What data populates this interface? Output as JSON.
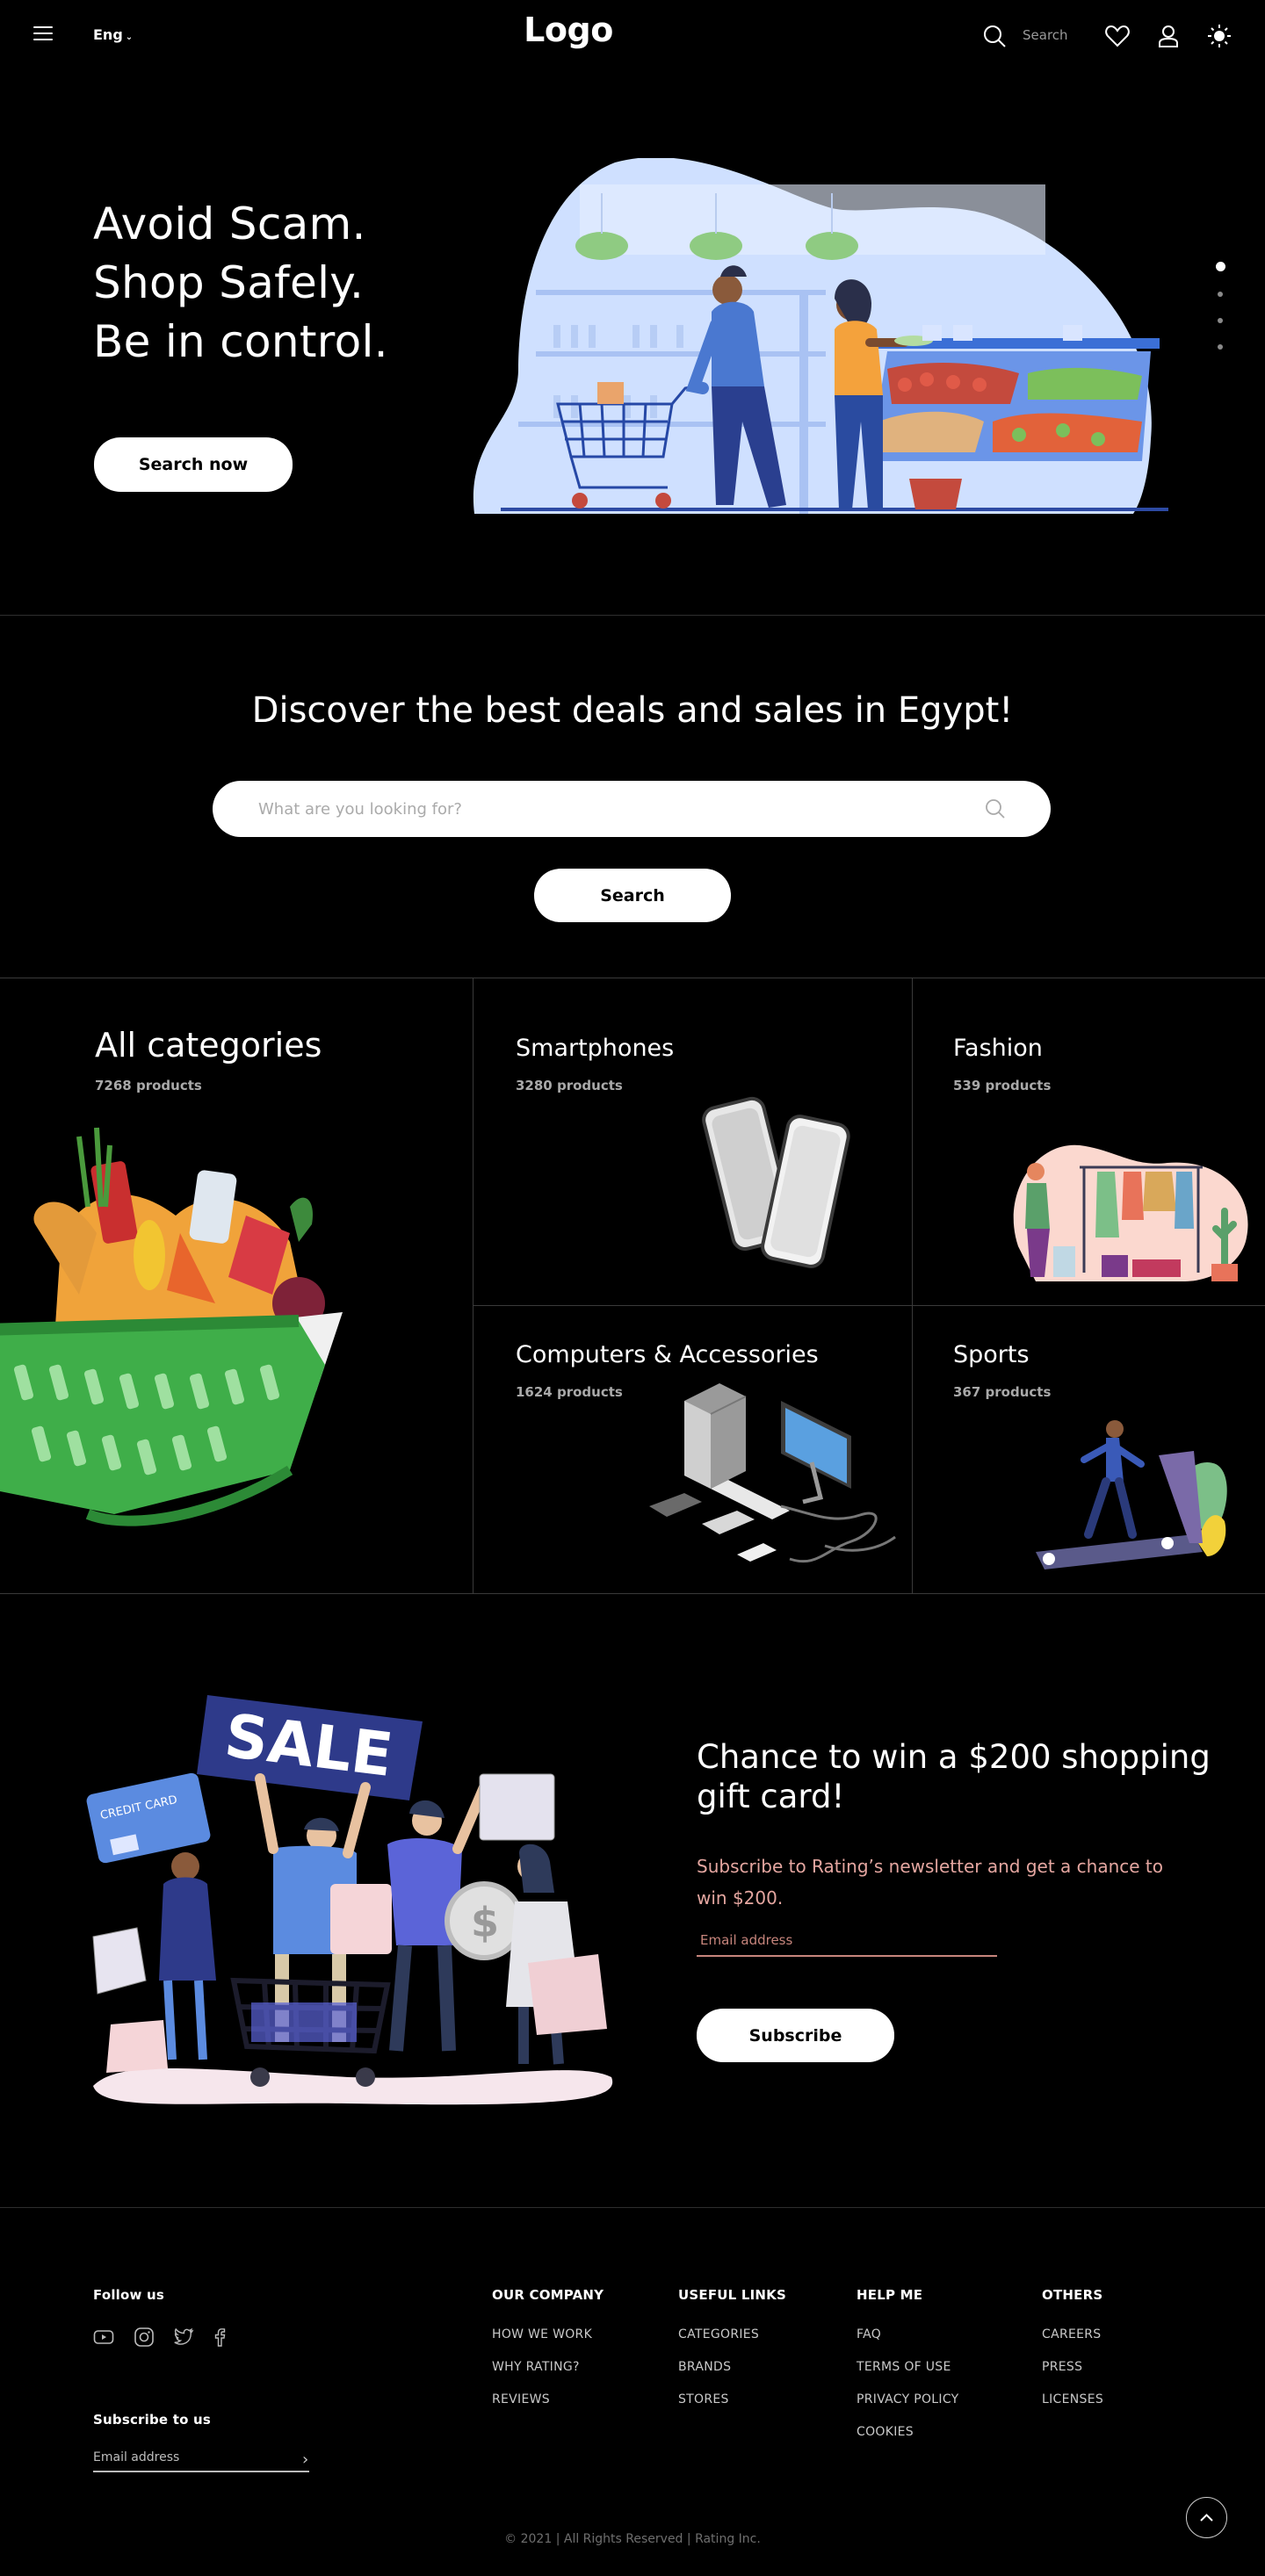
{
  "header": {
    "language": "Eng",
    "logo": "Logo",
    "search_label": "Search"
  },
  "hero": {
    "line1": "Avoid Scam.",
    "line2": "Shop Safely.",
    "line3": "Be in control.",
    "button": "Search now",
    "slide_count": 4,
    "active_slide": 1
  },
  "discover": {
    "title": "Discover the best deals and sales in Egypt!",
    "placeholder": "What are you looking for?",
    "button": "Search"
  },
  "categories": [
    {
      "name": "All categories",
      "count": "7268 products"
    },
    {
      "name": "Smartphones",
      "count": "3280 products"
    },
    {
      "name": "Fashion",
      "count": "539 products"
    },
    {
      "name": "Computers & Accessories",
      "count": "1624 products"
    },
    {
      "name": "Sports",
      "count": "367 products"
    }
  ],
  "promo": {
    "title": "Chance to win a $200 shopping gift card!",
    "text": "Subscribe to Rating’s newsletter and get a chance to win $200.",
    "email_placeholder": "Email address",
    "button": "Subscribe",
    "sale_sign": "SALE",
    "card_label": "CREDIT CARD"
  },
  "footer": {
    "follow_us": "Follow us",
    "subscribe_heading": "Subscribe to us",
    "email_placeholder": "Email address",
    "columns": [
      {
        "title": "OUR COMPANY",
        "links": [
          "HOW WE WORK",
          "WHY RATING?",
          "REVIEWS"
        ]
      },
      {
        "title": "USEFUL LINKS",
        "links": [
          "CATEGORIES",
          "BRANDS",
          "STORES"
        ]
      },
      {
        "title": "HELP ME",
        "links": [
          "FAQ",
          "TERMS OF USE",
          "PRIVACY POLICY",
          "COOKIES"
        ]
      },
      {
        "title": "OTHERS",
        "links": [
          "CAREERS",
          "PRESS",
          "LICENSES"
        ]
      }
    ],
    "copyright": "© 2021 | All Rights Reserved | Rating Inc."
  },
  "colors": {
    "background": "#000000",
    "accent_peach": "#e4a6a0",
    "hero_blue": "#cfe0ff",
    "basket_green": "#3fae49"
  }
}
